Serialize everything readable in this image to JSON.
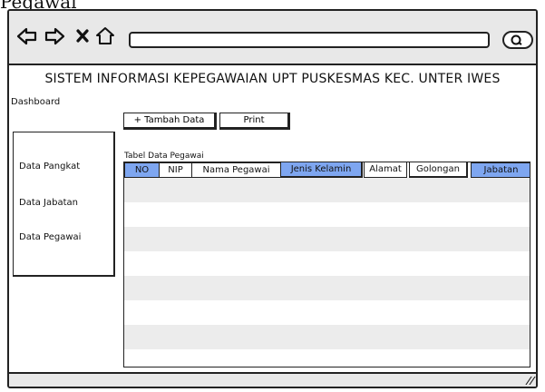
{
  "page_caption": "Pegawai",
  "app": {
    "title": "SISTEM INFORMASI KEPEGAWAIAN UPT PUSKESMAS KEC. UNTER IWES",
    "dashboard_label": "Dashboard"
  },
  "browser": {
    "icons": [
      "back-arrow-icon",
      "forward-arrow-icon",
      "close-icon",
      "home-icon",
      "search-icon"
    ],
    "address_value": ""
  },
  "toolbar": {
    "add_label": "+ Tambah Data",
    "print_label": "Print"
  },
  "sidebar": {
    "items": [
      {
        "label": "Data Pangkat"
      },
      {
        "label": "Data Jabatan"
      },
      {
        "label": "Data Pegawai"
      }
    ]
  },
  "table": {
    "caption": "Tabel Data Pegawai",
    "columns": [
      "NO",
      "NIP",
      "Nama Pegawai",
      "Jenis Kelamin",
      "Alamat",
      "Golongan",
      "Jabatan"
    ],
    "rows": []
  },
  "colors": {
    "accent": "#7ea6f0",
    "row_alt": "#ececec",
    "chrome": "#e8e8e8"
  }
}
